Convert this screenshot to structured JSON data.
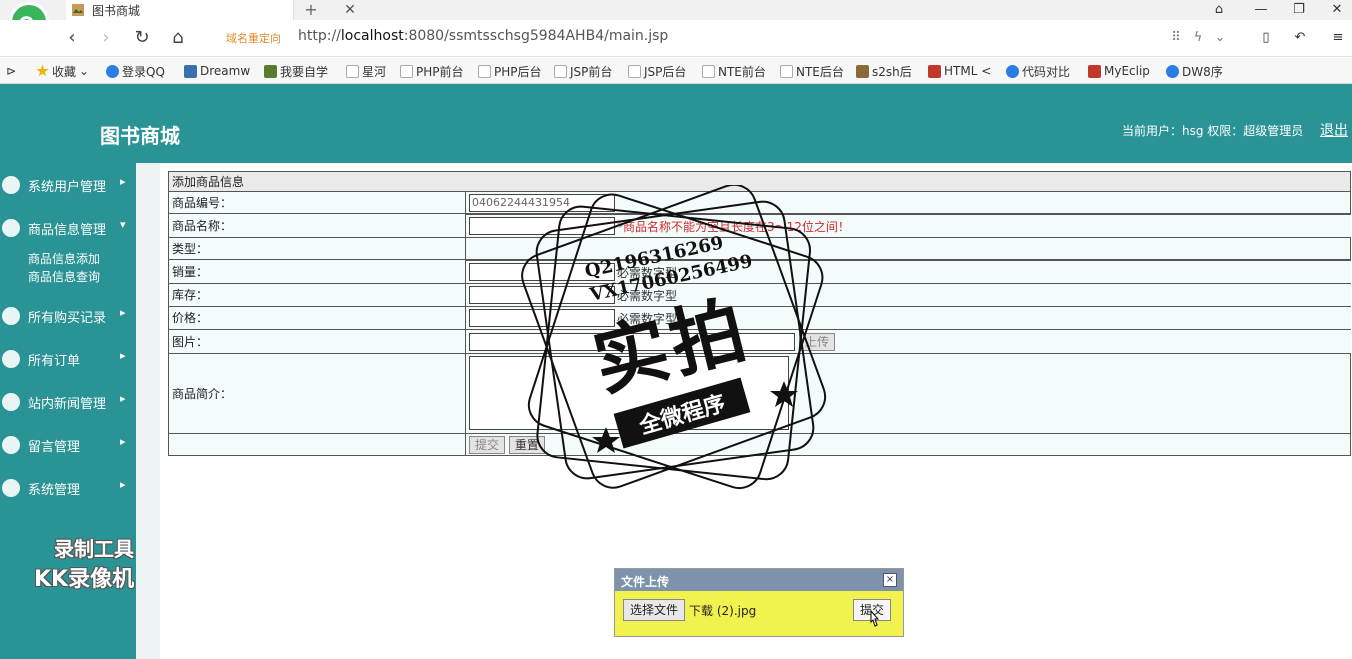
{
  "browser": {
    "tab_title": "图书商城",
    "redirect_label": "域名重定向",
    "url_prefix": "http://",
    "url_host": "localhost",
    "url_rest": ":8080/ssmtsschsg5984AHB4/main.jsp"
  },
  "bookmarks": [
    {
      "label": "收藏",
      "icon": "star-icon",
      "color": "#f0b400"
    },
    {
      "label": "登录QQ",
      "icon": "qq-icon",
      "color": "#2a7de1"
    },
    {
      "label": "Dreamw",
      "icon": "dreamweaver-icon",
      "color": "#3a6fb0"
    },
    {
      "label": "我要自学",
      "icon": "study-icon",
      "color": "#5a7a2e"
    },
    {
      "label": "星河",
      "icon": "page-icon",
      "color": "#bbbbbb"
    },
    {
      "label": "PHP前台",
      "icon": "page-icon",
      "color": "#bbbbbb"
    },
    {
      "label": "PHP后台",
      "icon": "page-icon",
      "color": "#bbbbbb"
    },
    {
      "label": "JSP前台",
      "icon": "page-icon",
      "color": "#bbbbbb"
    },
    {
      "label": "JSP后台",
      "icon": "page-icon",
      "color": "#bbbbbb"
    },
    {
      "label": "NTE前台",
      "icon": "page-icon",
      "color": "#bbbbbb"
    },
    {
      "label": "NTE后台",
      "icon": "page-icon",
      "color": "#bbbbbb"
    },
    {
      "label": "s2sh后",
      "icon": "image-icon",
      "color": "#8a6a3a"
    },
    {
      "label": "HTML <",
      "icon": "html-icon",
      "color": "#c0392b"
    },
    {
      "label": "代码对比",
      "icon": "compare-icon",
      "color": "#2a7de1"
    },
    {
      "label": "MyEclip",
      "icon": "myeclipse-icon",
      "color": "#c0392b"
    },
    {
      "label": "DW8序",
      "icon": "paw-icon",
      "color": "#2a7de1"
    }
  ],
  "app": {
    "title": "图书商城",
    "user_info": "当前用户：hsg  权限：超级管理员",
    "logout": "退出"
  },
  "sidebar": {
    "items": [
      {
        "label": "系统用户管理",
        "icon": "user-circle-icon"
      },
      {
        "label": "商品信息管理",
        "icon": "users-icon"
      },
      {
        "label": "所有购买记录",
        "icon": "record-icon"
      },
      {
        "label": "所有订单",
        "icon": "app-icon"
      },
      {
        "label": "站内新闻管理",
        "icon": "cloud-icon"
      },
      {
        "label": "留言管理",
        "icon": "layers-icon"
      },
      {
        "label": "系统管理",
        "icon": "chart-icon"
      }
    ],
    "sub_items": [
      "商品信息添加",
      "商品信息查询"
    ]
  },
  "form": {
    "caption": "添加商品信息",
    "rows": {
      "code_label": "商品编号：",
      "code_value": "04062244431954",
      "name_label": "商品名称：",
      "name_error": "*商品名称不能为空且长度在3～12位之间！",
      "type_label": "类型：",
      "sales_label": "销量：",
      "sales_hint": "必需数字型",
      "stock_label": "库存：",
      "stock_hint": "必需数字型",
      "price_label": "价格：",
      "price_hint": "必需数字型",
      "image_label": "图片：",
      "upload_button": "上传",
      "desc_label": "商品简介："
    },
    "submit": "提交",
    "reset": "重置"
  },
  "upload_dialog": {
    "title": "文件上传",
    "close": "×",
    "choose": "选择文件",
    "file_name": "下载 (2).jpg",
    "submit": "提交"
  },
  "overlay": {
    "recorder_line1": "录制工具",
    "recorder_line2": "KK录像机",
    "stamp_qq": "Q2196316269",
    "stamp_vx": "VX17060256499",
    "stamp_big": "实拍",
    "stamp_banner": "全微程序"
  }
}
